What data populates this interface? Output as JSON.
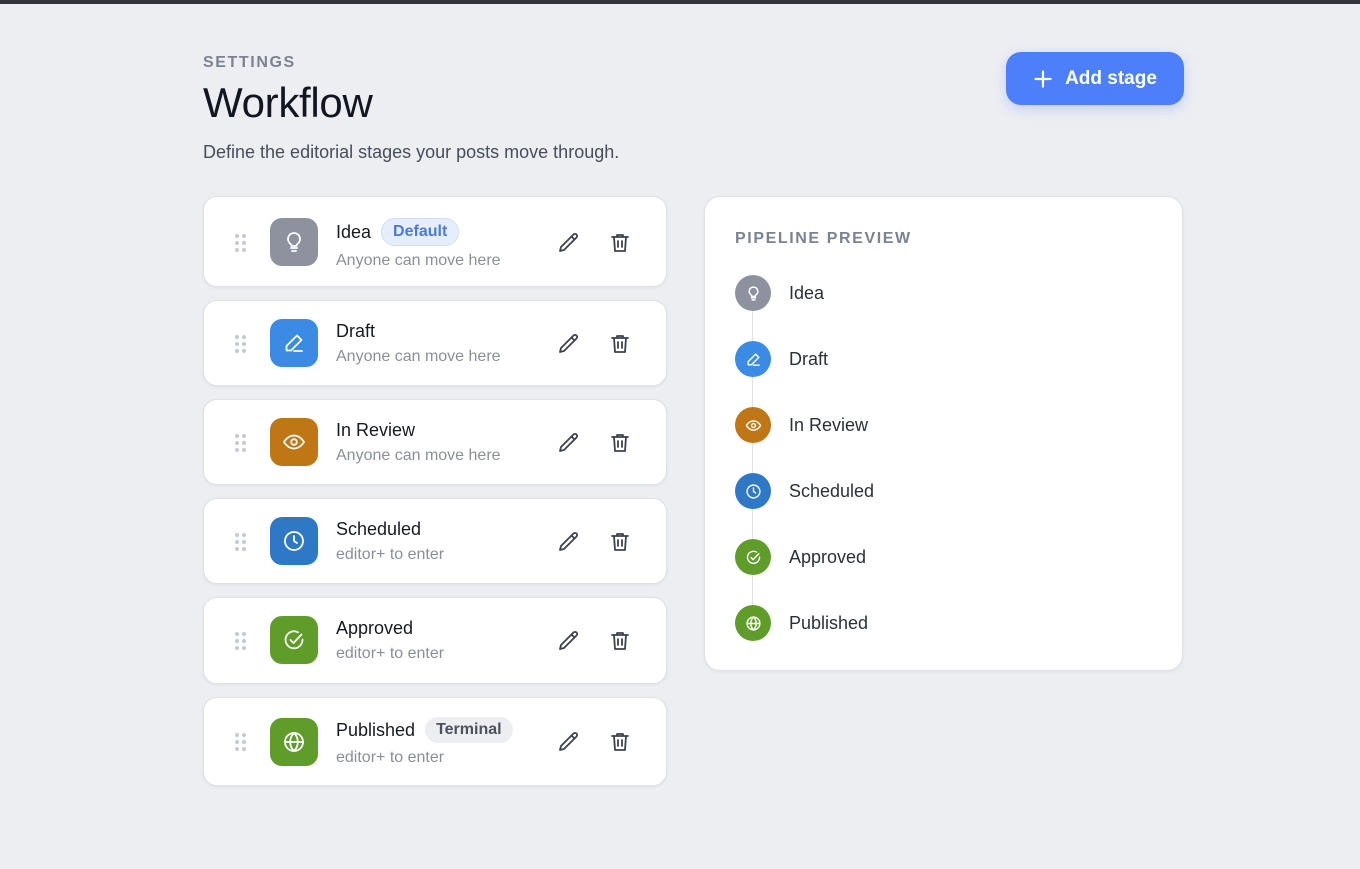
{
  "header": {
    "eyebrow": "SETTINGS",
    "title": "Workflow",
    "subtitle": "Define the editorial stages your posts move through."
  },
  "add_button": {
    "label": "Add stage",
    "icon": "plus-icon",
    "color": "#4d7ffa"
  },
  "stages": [
    {
      "name": "Idea",
      "badge": "Default",
      "badge_style": "default",
      "subtitle": "Anyone can move here",
      "icon": "lightbulb-icon",
      "color": "#8e929f"
    },
    {
      "name": "Draft",
      "badge": "",
      "badge_style": "",
      "subtitle": "Anyone can move here",
      "icon": "pen-icon",
      "color": "#3b8ae4"
    },
    {
      "name": "In Review",
      "badge": "",
      "badge_style": "",
      "subtitle": "Anyone can move here",
      "icon": "eye-icon",
      "color": "#bf7615"
    },
    {
      "name": "Scheduled",
      "badge": "",
      "badge_style": "",
      "subtitle": "editor+ to enter",
      "icon": "clock-icon",
      "color": "#2f78c5"
    },
    {
      "name": "Approved",
      "badge": "",
      "badge_style": "",
      "subtitle": "editor+ to enter",
      "icon": "check-circle-icon",
      "color": "#5f9c2a"
    },
    {
      "name": "Published",
      "badge": "Terminal",
      "badge_style": "terminal",
      "subtitle": "editor+ to enter",
      "icon": "globe-icon",
      "color": "#5f9c2a"
    }
  ],
  "stage_actions": {
    "edit_icon": "pencil-icon",
    "delete_icon": "trash-icon",
    "drag_icon": "drag-handle-icon"
  },
  "preview": {
    "title": "PIPELINE PREVIEW",
    "items": [
      "Idea",
      "Draft",
      "In Review",
      "Scheduled",
      "Approved",
      "Published"
    ]
  }
}
